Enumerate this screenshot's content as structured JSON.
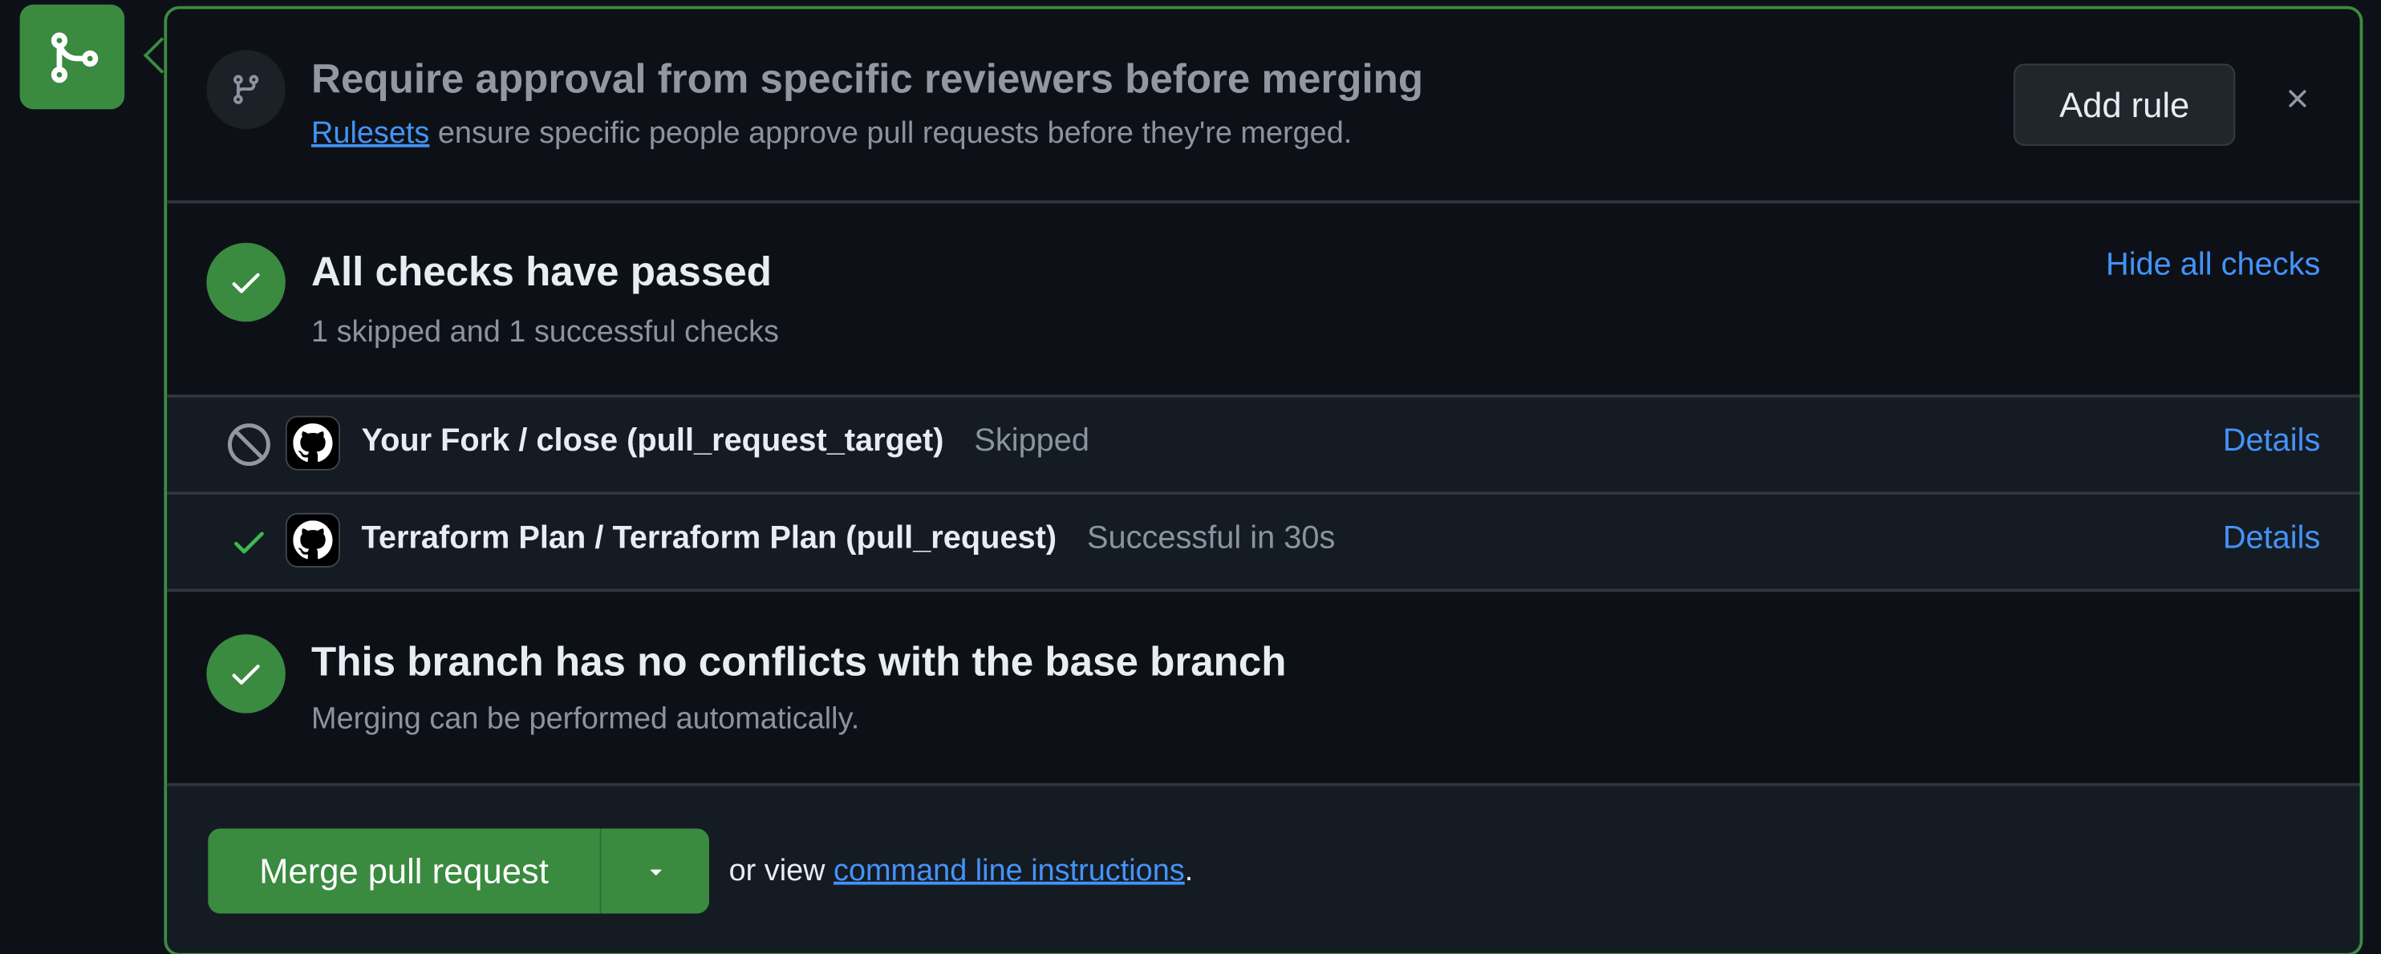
{
  "merge_icon": "git-merge-icon",
  "ruleset_prompt": {
    "icon": "git-branch-icon",
    "title": "Require approval from specific reviewers before merging",
    "link_text": "Rulesets",
    "description": " ensure specific people approve pull requests before they're merged.",
    "add_rule_label": "Add rule",
    "close_icon": "close-icon"
  },
  "checks_summary": {
    "icon": "check-circle-icon",
    "title": "All checks have passed",
    "subtitle": "1 skipped and 1 successful checks",
    "toggle_label": "Hide all checks"
  },
  "checks": [
    {
      "status_icon": "skip-icon",
      "avatar": "github-icon",
      "name": "Your Fork / close (pull_request_target)",
      "status": "Skipped",
      "details_label": "Details"
    },
    {
      "status_icon": "check-icon",
      "avatar": "github-icon",
      "name": "Terraform Plan / Terraform Plan (pull_request)",
      "status": "Successful in 30s",
      "details_label": "Details"
    }
  ],
  "conflicts": {
    "icon": "check-circle-icon",
    "title": "This branch has no conflicts with the base branch",
    "subtitle": "Merging can be performed automatically."
  },
  "merge_footer": {
    "merge_label": "Merge pull request",
    "dropdown_icon": "triangle-down-icon",
    "or_view_text": "or view ",
    "cli_link_text": "command line instructions",
    "period": "."
  },
  "colors": {
    "background": "#0d1117",
    "success_green": "#3a8a40",
    "link_blue": "#4493f8",
    "muted_text": "#8b949e",
    "border": "#30363d"
  }
}
